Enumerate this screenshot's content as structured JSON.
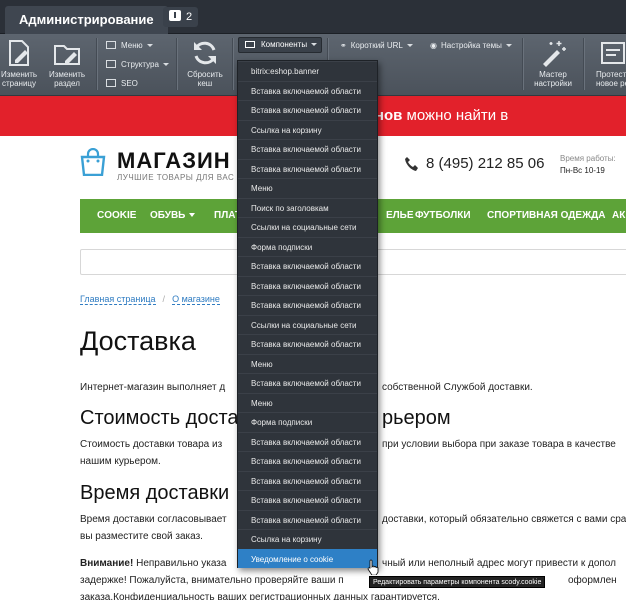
{
  "admin": {
    "tab_label": "Администрирование",
    "notifications_count": "2"
  },
  "toolbar": {
    "edit_page": "Изменить\nстраницу",
    "edit_section": "Изменить\nраздел",
    "menu": "Меню",
    "structure": "Структура",
    "seo": "SEO",
    "reset_cache": "Сбросить\nкеш",
    "components": "Компоненты",
    "short_url": "Короткий URL",
    "theme_settings": "Настройка темы",
    "wizard": "Мастер\nнастройки",
    "test_new": "Протест\nновое ре"
  },
  "banner": {
    "bold_text": "Интернет-магазинов",
    "text": "можно найти в"
  },
  "header": {
    "logo": "МАГАЗИН",
    "slogan": "ЛУЧШИЕ ТОВАРЫ ДЛЯ ВАС",
    "phone": "8 (495) 212 85 06",
    "work_hours_label": "Время работы:",
    "work_hours": "Пн-Вс 10-19"
  },
  "menu": {
    "items": [
      "COOKIE",
      "ОБУВЬ",
      "ПЛАТ",
      "ЕЛЬЕ",
      "ФУТБОЛКИ",
      "СПОРТИВНАЯ ОДЕЖДА",
      "АК"
    ]
  },
  "breadcrumbs": [
    "Главная страница",
    "О магазине"
  ],
  "content": {
    "title": "Доставка",
    "p1_a": "Интернет-магазин выполняет д",
    "p1_b": "собственной Службой доставки.",
    "h_cost_a": "Стоимость доста",
    "h_cost_b": "рьером",
    "cost_a": "Стоимость доставки товара из",
    "cost_b": "при условии выбора при заказе товара в качестве",
    "cost_c": "нашим курьером.",
    "h_time": "Время доставки",
    "time_a": "Время доставки согласовывает",
    "time_b": "доставки, который обязательно свяжется с вами сра",
    "time_c": "вы разместите свой заказ.",
    "note_bold": "Внимание!",
    "note_a": "Неправильно указа",
    "note_b": "чный или неполный адрес могут привести к допол",
    "note_c": "задержке! Пожалуйста, внимательно проверяйте ваши п",
    "note_d": "оформлен",
    "note_e": "заказа.Конфиденциальность ваших регистрационных данных гарантируется."
  },
  "dropdown": {
    "items": [
      "bitrix:eshop.banner",
      "Вставка включаемой области",
      "Вставка включаемой области",
      "Ссылка на корзину",
      "Вставка включаемой области",
      "Вставка включаемой области",
      "Меню",
      "Поиск по заголовкам",
      "Ссылки на социальные сети",
      "Форма подписки",
      "Вставка включаемой области",
      "Вставка включаемой области",
      "Вставка включаемой области",
      "Ссылки на социальные сети",
      "Вставка включаемой области",
      "Меню",
      "Вставка включаемой области",
      "Меню",
      "Форма подписки",
      "Вставка включаемой области",
      "Вставка включаемой области",
      "Вставка включаемой области",
      "Вставка включаемой области",
      "Вставка включаемой области",
      "Ссылка на корзину",
      "Уведомление о cookie"
    ],
    "tooltip": "Редактировать параметры компонента scody.cookie"
  },
  "colors": {
    "banner": "#e2212b",
    "menu": "#5da338",
    "accent": "#2e80c6",
    "admin_bg": "#2b3038"
  }
}
